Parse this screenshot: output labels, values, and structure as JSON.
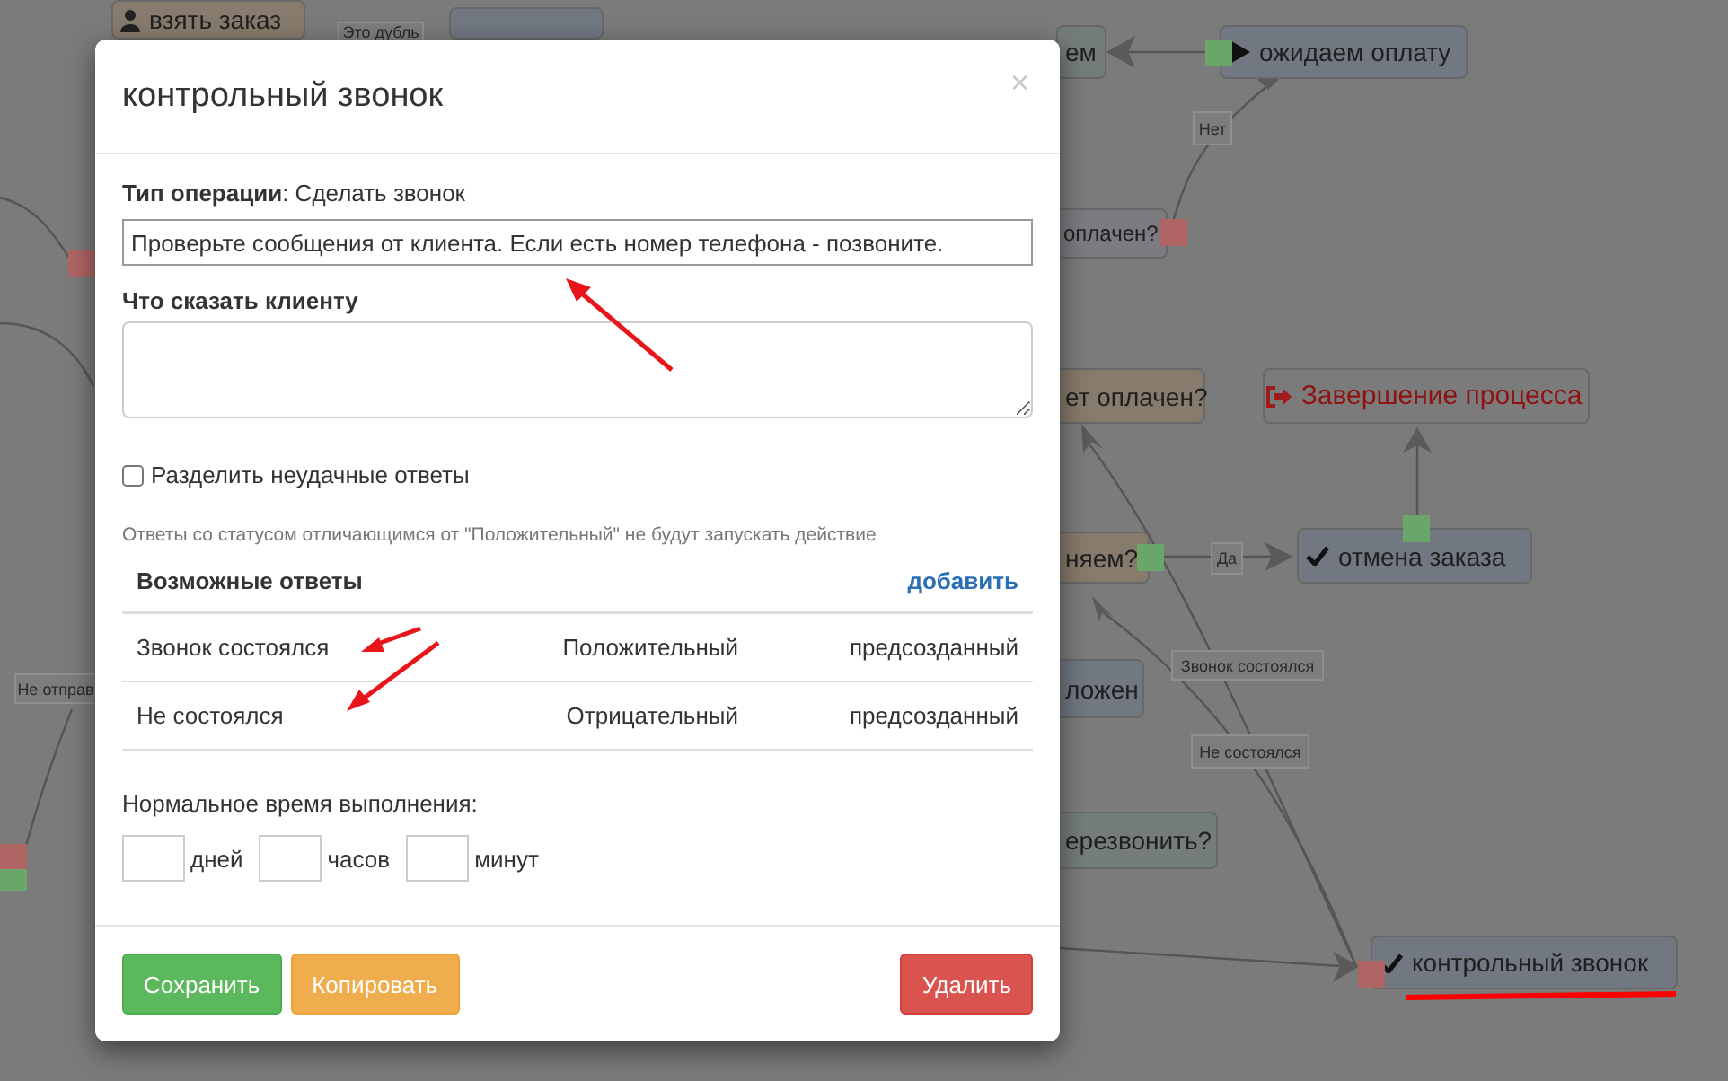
{
  "canvas": {
    "items": [
      {
        "kind": "node",
        "text": "взять заказ"
      },
      {
        "kind": "label",
        "text": "Это дубль"
      },
      {
        "kind": "node"
      },
      {
        "kind": "node",
        "text": "ем"
      },
      {
        "kind": "node",
        "text": "ожидаем оплату"
      },
      {
        "kind": "port",
        "color": "#6aa56a"
      },
      {
        "kind": "label",
        "text": "Нет"
      },
      {
        "kind": "node",
        "text": "оплачен?"
      },
      {
        "kind": "port",
        "color": "#b06565"
      },
      {
        "kind": "node",
        "text": "ет оплачен?"
      },
      {
        "kind": "node",
        "text": "Завершение процесса"
      },
      {
        "kind": "node",
        "text": "няем?"
      },
      {
        "kind": "port",
        "color": "#6aa56a"
      },
      {
        "kind": "label",
        "text": "Да"
      },
      {
        "kind": "node",
        "text": "отмена заказа"
      },
      {
        "kind": "port",
        "color": "#6aa56a"
      },
      {
        "kind": "label",
        "text": "Звонок состоялся"
      },
      {
        "kind": "node",
        "text": "ложен"
      },
      {
        "kind": "label",
        "text": "Не состоялся"
      },
      {
        "kind": "node",
        "text": "ерезвонить?"
      },
      {
        "kind": "node",
        "text": "контрольный звонок"
      },
      {
        "kind": "port",
        "color": "#b06565"
      },
      {
        "kind": "label",
        "text": "Не отправ"
      },
      {
        "kind": "port",
        "color": "#b06565"
      },
      {
        "kind": "port",
        "color": "#b06565"
      },
      {
        "kind": "port",
        "color": "#6aa56a"
      }
    ]
  },
  "dialog": {
    "title": "контрольный звонок",
    "close": "×",
    "operation": "**Тип операции**: Сделать звонок",
    "instruction_field": {
      "value": "Проверьте сообщения от клиента. Если есть номер телефона - позвоните."
    },
    "say_label": "Что сказать клиенту",
    "split_checkbox": {
      "label": "Разделить неудачные ответы",
      "checked": false
    },
    "note": "Ответы со статусом отличающимся от \"Положительный\" не будут запускать действие",
    "answers": {
      "title": "Возможные ответы",
      "add": "добавить",
      "rows": [
        {
          "answer": "Звонок состоялся",
          "status": "Положительный",
          "origin": "предсозданный"
        },
        {
          "answer": "Не состоялся",
          "status": "Отрицательный",
          "origin": "предсозданный"
        }
      ]
    },
    "duration": {
      "label": "Нормальное время выполнения:",
      "units": [
        "дней",
        "часов",
        "минут"
      ]
    },
    "buttons": [
      {
        "label": "Сохранить",
        "kind": "success"
      },
      {
        "label": "Копировать",
        "kind": "warning"
      },
      {
        "label": "Удалить",
        "kind": "danger"
      }
    ]
  }
}
